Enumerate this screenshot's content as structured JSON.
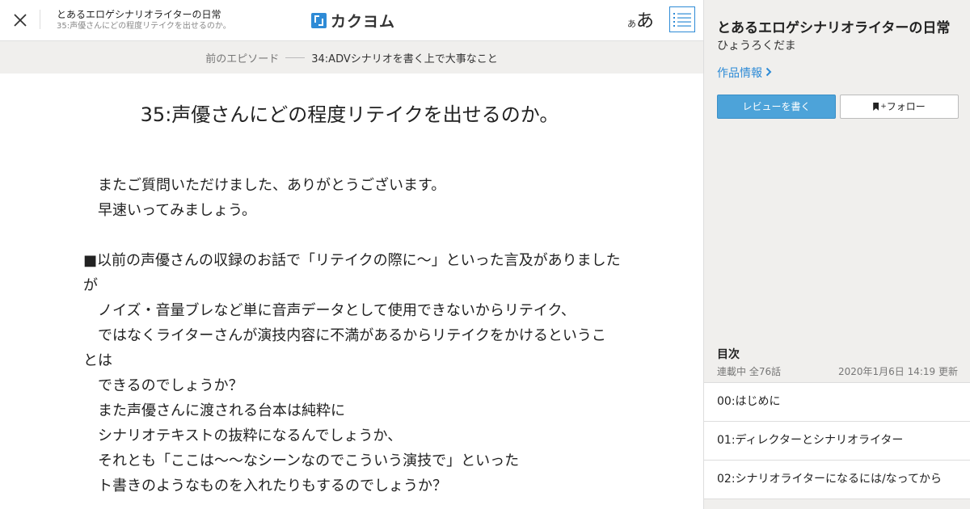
{
  "header": {
    "work_title": "とあるエロゲシナリオライターの日常",
    "episode_title": "35:声優さんにどの程度リテイクを出せるのか。",
    "logo_text": "カクヨム",
    "font_size_small": "あ",
    "font_size_large": "あ",
    "accent_color": "#2e8bd6"
  },
  "episode_nav": {
    "prev_label": "前のエピソード",
    "prev_title": "34:ADVシナリオを書く上で大事なこと"
  },
  "episode": {
    "heading": "35:声優さんにどの程度リテイクを出せるのか。",
    "lines": [
      "　またご質問いただけました、ありがとうございます。",
      "　早速いってみましょう。",
      "",
      "■以前の声優さんの収録のお話で「リテイクの際に～」といった言及がありました",
      "が",
      "　ノイズ・音量ブレなど単に音声データとして使用できないからリテイク、",
      "　ではなくライターさんが演技内容に不満があるからリテイクをかけるというこ",
      "とは",
      "　できるのでしょうか？",
      "　また声優さんに渡される台本は純粋に",
      "　シナリオテキストの抜粋になるんでしょうか、",
      "　それとも「ここは～～なシーンなのでこういう演技で」といった",
      "　ト書きのようなものを入れたりもするのでしょうか？"
    ]
  },
  "sidebar": {
    "title": "とあるエロゲシナリオライターの日常",
    "author": "ひょうろくだま",
    "work_info_link": "作品情報",
    "review_button": "レビューを書く",
    "follow_button": "フォロー",
    "toc_heading": "目次",
    "toc_status": "連載中 全76話",
    "toc_updated": "2020年1月6日 14:19 更新",
    "toc_items": [
      "00:はじめに",
      "01:ディレクターとシナリオライター",
      "02:シナリオライターになるには/なってから"
    ]
  }
}
